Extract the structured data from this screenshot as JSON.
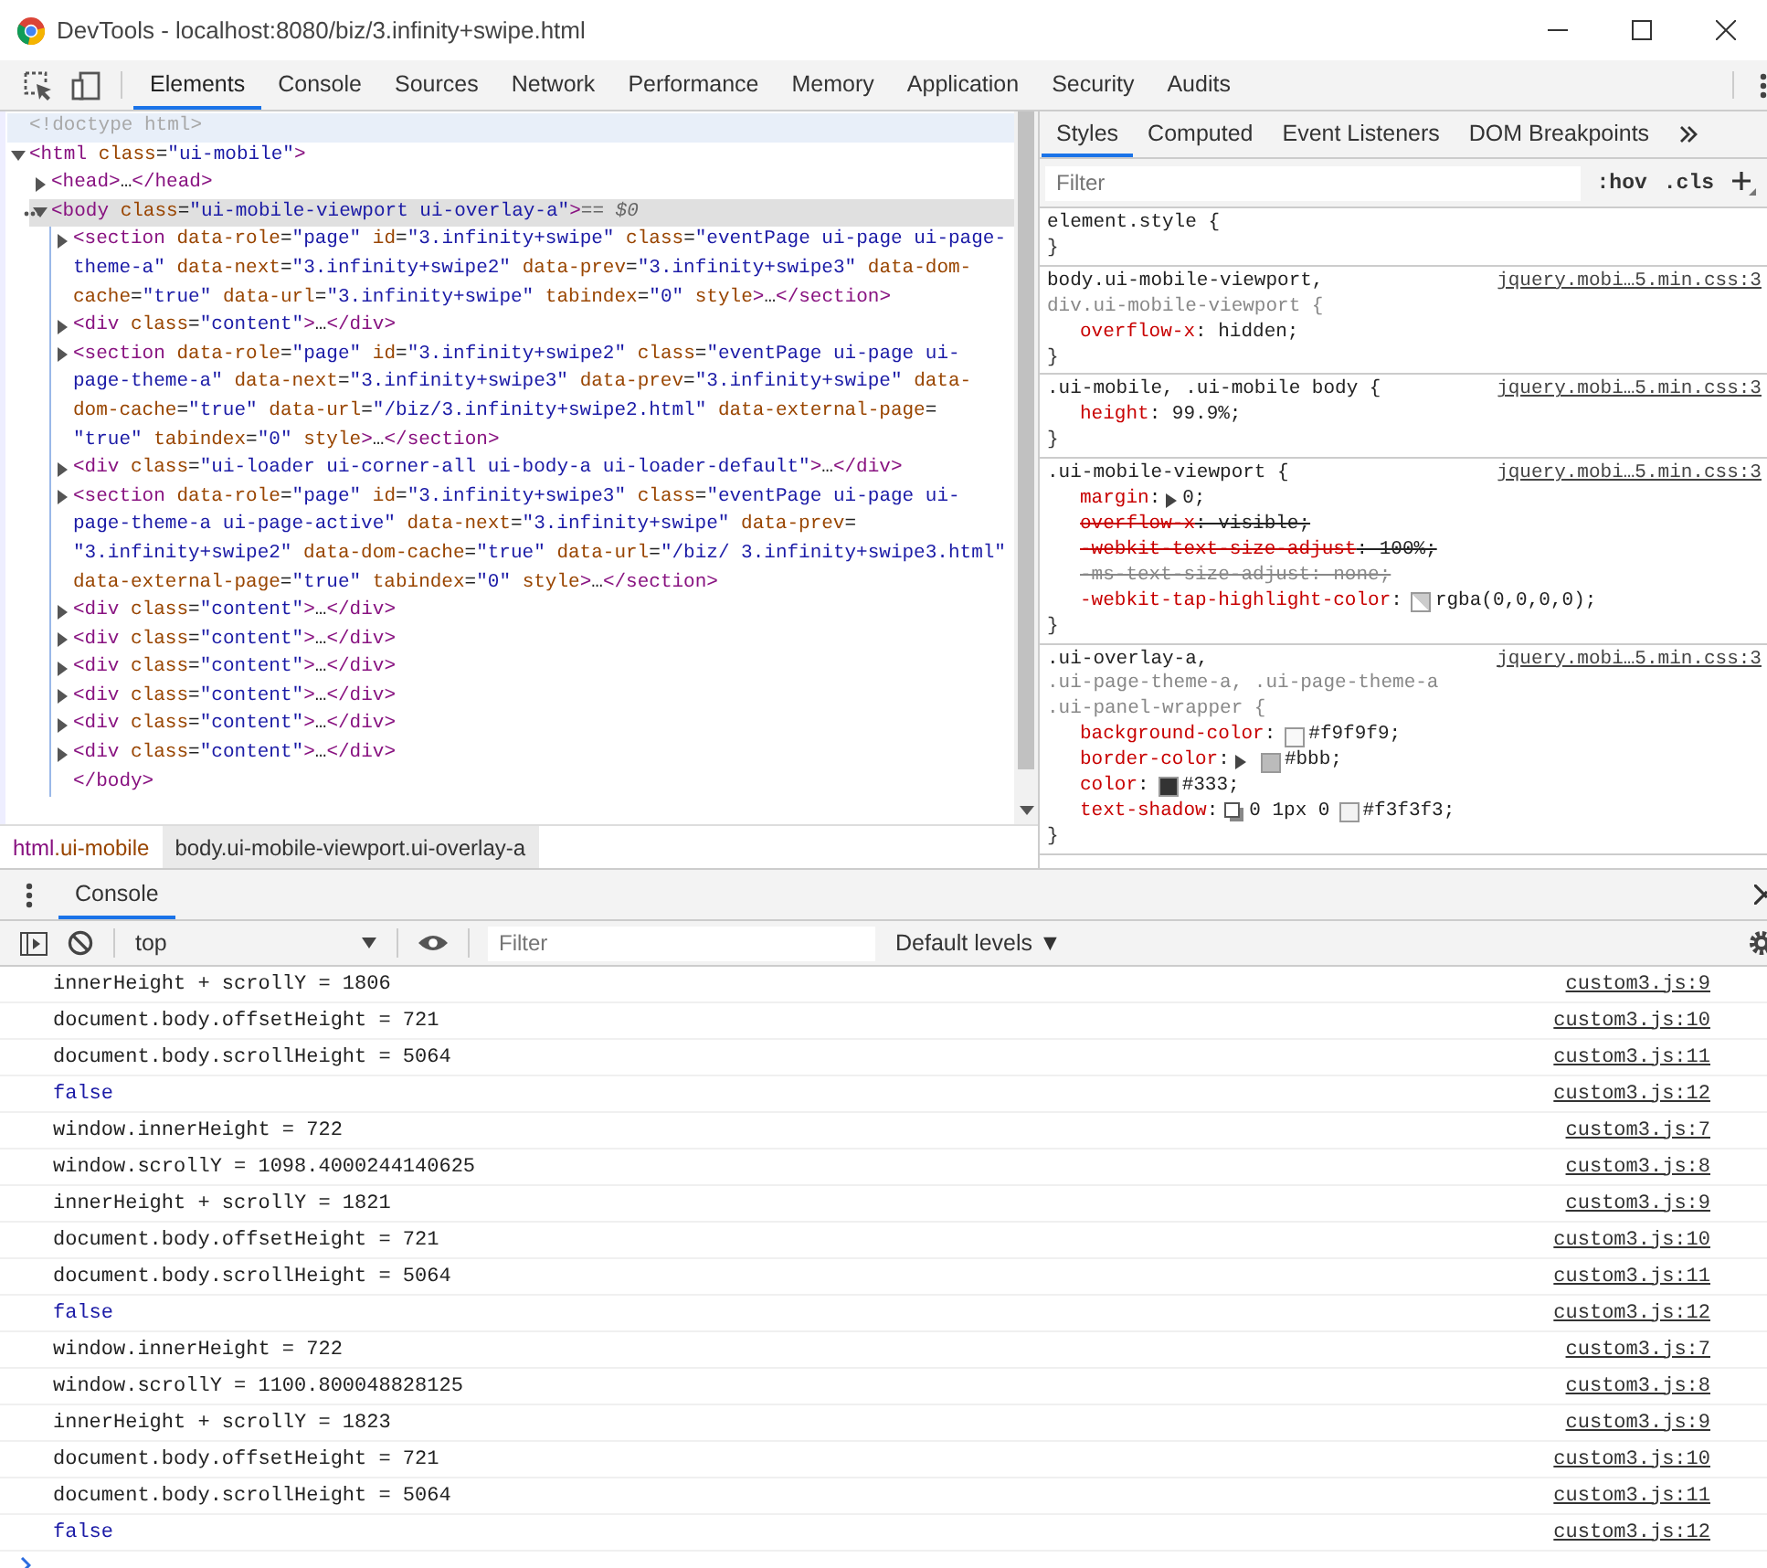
{
  "window": {
    "title": "DevTools - localhost:8080/biz/3.infinity+swipe.html"
  },
  "main_tabs": [
    {
      "label": "Elements",
      "selected": true
    },
    {
      "label": "Console",
      "selected": false
    },
    {
      "label": "Sources",
      "selected": false
    },
    {
      "label": "Network",
      "selected": false
    },
    {
      "label": "Performance",
      "selected": false
    },
    {
      "label": "Memory",
      "selected": false
    },
    {
      "label": "Application",
      "selected": false
    },
    {
      "label": "Security",
      "selected": false
    },
    {
      "label": "Audits",
      "selected": false
    }
  ],
  "elements": {
    "nodes": [
      {
        "kind": "doctype",
        "text": "<!doctype html>",
        "selected": false,
        "hovered": true
      },
      {
        "kind": "element",
        "text": "<html class=\"ui-mobile\">",
        "expanded": true,
        "selected": false,
        "hovered": false,
        "children": [
          {
            "kind": "element",
            "text": "<head>…</head>",
            "expanded": false,
            "selected": false,
            "hovered": false
          },
          {
            "kind": "element",
            "text": "<body class=\"ui-mobile-viewport ui-overlay-a\">",
            "suffix": "== $0",
            "expanded": true,
            "selected": true,
            "hovered": false,
            "close": "</body>",
            "children": [
              {
                "kind": "element",
                "text": "<section data-role=\"page\" id=\"3.infinity+swipe\" class=\"eventPage ui-page ui-page-theme-a\" data-next=\"3.infinity+swipe2\" data-prev=\"3.infinity+swipe3\" data-dom-cache=\"true\" data-url=\"3.infinity+swipe\" tabindex=\"0\" style>…</section>",
                "expanded": false,
                "selected": false,
                "hovered": false
              },
              {
                "kind": "element",
                "text": "<div class=\"content\">…</div>",
                "expanded": false,
                "selected": false,
                "hovered": false
              },
              {
                "kind": "element",
                "text": "<section data-role=\"page\" id=\"3.infinity+swipe2\" class=\"eventPage ui-page ui-page-theme-a\" data-next=\"3.infinity+swipe3\" data-prev=\"3.infinity+swipe\" data-dom-cache=\"true\" data-url=\"/biz/3.infinity+swipe2.html\" data-external-page= \"true\" tabindex=\"0\" style>…</section>",
                "expanded": false,
                "selected": false,
                "hovered": false
              },
              {
                "kind": "element",
                "text": "<div class=\"ui-loader ui-corner-all ui-body-a ui-loader-default\">…</div>",
                "expanded": false,
                "selected": false,
                "hovered": false
              },
              {
                "kind": "element",
                "text": "<section data-role=\"page\" id=\"3.infinity+swipe3\" class=\"eventPage ui-page ui-page-theme-a ui-page-active\" data-next=\"3.infinity+swipe\" data-prev= \"3.infinity+swipe2\" data-dom-cache=\"true\" data-url=\"/biz/ 3.infinity+swipe3.html\" data-external-page=\"true\" tabindex=\"0\" style>…</section>",
                "expanded": false,
                "selected": false,
                "hovered": false
              },
              {
                "kind": "element",
                "text": "<div class=\"content\">…</div>",
                "expanded": false,
                "selected": false,
                "hovered": false
              },
              {
                "kind": "element",
                "text": "<div class=\"content\">…</div>",
                "expanded": false,
                "selected": false,
                "hovered": false
              },
              {
                "kind": "element",
                "text": "<div class=\"content\">…</div>",
                "expanded": false,
                "selected": false,
                "hovered": false
              },
              {
                "kind": "element",
                "text": "<div class=\"content\">…</div>",
                "expanded": false,
                "selected": false,
                "hovered": false
              },
              {
                "kind": "element",
                "text": "<div class=\"content\">…</div>",
                "expanded": false,
                "selected": false,
                "hovered": false
              },
              {
                "kind": "element",
                "text": "<div class=\"content\">…</div>",
                "expanded": false,
                "selected": false,
                "hovered": false
              }
            ]
          }
        ]
      }
    ]
  },
  "breadcrumbs": [
    {
      "tag": "html",
      "classes": ".ui-mobile",
      "selected": false
    },
    {
      "tag": "body",
      "classes": ".ui-mobile-viewport.ui-overlay-a",
      "selected": true
    }
  ],
  "styles_tabs": [
    {
      "label": "Styles",
      "selected": true
    },
    {
      "label": "Computed",
      "selected": false
    },
    {
      "label": "Event Listeners",
      "selected": false
    },
    {
      "label": "DOM Breakpoints",
      "selected": false
    }
  ],
  "styles_filter": {
    "placeholder": "Filter",
    "buttons": [
      ":hov",
      ".cls"
    ]
  },
  "rules": [
    {
      "selectors": [
        {
          "text": "element.style {",
          "matched": true
        }
      ],
      "close": "}"
    },
    {
      "selectors": [
        {
          "text": "body.ui-mobile-viewport,",
          "matched": true
        },
        {
          "text": "div.ui-mobile-viewport {",
          "matched": false
        }
      ],
      "source": "jquery.mobi…5.min.css:3",
      "properties": [
        {
          "overridden": false,
          "supported": true,
          "parts": [
            {
              "kind": "name",
              "text": "overflow-x"
            },
            {
              "kind": "text",
              "text": ": hidden;"
            }
          ]
        }
      ],
      "close": "}"
    },
    {
      "selectors": [
        {
          "text": ".ui-mobile, .ui-mobile body {",
          "matched": true
        }
      ],
      "source": "jquery.mobi…5.min.css:3",
      "properties": [
        {
          "overridden": false,
          "supported": true,
          "parts": [
            {
              "kind": "name",
              "text": "height"
            },
            {
              "kind": "text",
              "text": ": 99.9%;"
            }
          ]
        }
      ],
      "close": "}"
    },
    {
      "selectors": [
        {
          "text": ".ui-mobile-viewport {",
          "matched": true
        }
      ],
      "source": "jquery.mobi…5.min.css:3",
      "properties": [
        {
          "overridden": false,
          "supported": true,
          "parts": [
            {
              "kind": "name",
              "text": "margin"
            },
            {
              "kind": "text",
              "text": ":"
            },
            {
              "kind": "expander"
            },
            {
              "kind": "text",
              "text": "0;"
            }
          ]
        },
        {
          "overridden": true,
          "supported": true,
          "parts": [
            {
              "kind": "name",
              "text": "overflow-x"
            },
            {
              "kind": "text",
              "text": ": visible;"
            }
          ]
        },
        {
          "overridden": true,
          "supported": true,
          "parts": [
            {
              "kind": "name",
              "text": "-webkit-text-size-adjust"
            },
            {
              "kind": "text",
              "text": ": 100%;"
            }
          ]
        },
        {
          "overridden": false,
          "supported": false,
          "parts": [
            {
              "kind": "name",
              "text": "-ms-text-size-adjust"
            },
            {
              "kind": "text",
              "text": ": none;"
            }
          ]
        },
        {
          "overridden": false,
          "supported": true,
          "parts": [
            {
              "kind": "name",
              "text": "-webkit-tap-highlight-color"
            },
            {
              "kind": "text",
              "text": ":"
            },
            {
              "kind": "checker-swatch"
            },
            {
              "kind": "text",
              "text": "rgba(0,0,0,0);"
            }
          ]
        }
      ],
      "close": "}"
    },
    {
      "selectors": [
        {
          "text": ".ui-overlay-a,",
          "matched": true
        },
        {
          "text": ".ui-page-theme-a, .ui-page-theme-a .ui-panel-wrapper {",
          "matched": false
        }
      ],
      "source": "jquery.mobi…5.min.css:3",
      "properties": [
        {
          "overridden": false,
          "supported": true,
          "parts": [
            {
              "kind": "name",
              "text": "background-color"
            },
            {
              "kind": "text",
              "text": ":"
            },
            {
              "kind": "swatch",
              "color": "#f9f9f9"
            },
            {
              "kind": "text",
              "text": "#f9f9f9;"
            }
          ]
        },
        {
          "overridden": false,
          "supported": true,
          "parts": [
            {
              "kind": "name",
              "text": "border-color"
            },
            {
              "kind": "text",
              "text": ":"
            },
            {
              "kind": "expander"
            },
            {
              "kind": "swatch",
              "color": "#bbbbbb"
            },
            {
              "kind": "text",
              "text": "#bbb;"
            }
          ]
        },
        {
          "overridden": false,
          "supported": true,
          "parts": [
            {
              "kind": "name",
              "text": "color"
            },
            {
              "kind": "text",
              "text": ":"
            },
            {
              "kind": "swatch",
              "color": "#333333"
            },
            {
              "kind": "text",
              "text": "#333;"
            }
          ]
        },
        {
          "overridden": false,
          "supported": true,
          "parts": [
            {
              "kind": "name",
              "text": "text-shadow"
            },
            {
              "kind": "text",
              "text": ":"
            },
            {
              "kind": "shadow"
            },
            {
              "kind": "text",
              "text": "0 1px 0"
            },
            {
              "kind": "swatch",
              "color": "#f3f3f3"
            },
            {
              "kind": "text",
              "text": "#f3f3f3;"
            }
          ]
        }
      ],
      "close": "}"
    }
  ],
  "drawer_tabs": [
    {
      "label": "Console",
      "selected": true
    }
  ],
  "console": {
    "context": "top",
    "filter_placeholder": "Filter",
    "levels": "Default levels ▼",
    "messages": [
      {
        "kind": "log",
        "text": "innerHeight + scrollY = 1806",
        "source": "custom3.js:9"
      },
      {
        "kind": "log",
        "text": "document.body.offsetHeight = 721",
        "source": "custom3.js:10"
      },
      {
        "kind": "log",
        "text": "document.body.scrollHeight = 5064",
        "source": "custom3.js:11"
      },
      {
        "kind": "boolean",
        "text": "false",
        "source": "custom3.js:12"
      },
      {
        "kind": "log",
        "text": "window.innerHeight = 722",
        "source": "custom3.js:7"
      },
      {
        "kind": "log",
        "text": "window.scrollY = 1098.4000244140625",
        "source": "custom3.js:8"
      },
      {
        "kind": "log",
        "text": "innerHeight + scrollY = 1821",
        "source": "custom3.js:9"
      },
      {
        "kind": "log",
        "text": "document.body.offsetHeight = 721",
        "source": "custom3.js:10"
      },
      {
        "kind": "log",
        "text": "document.body.scrollHeight = 5064",
        "source": "custom3.js:11"
      },
      {
        "kind": "boolean",
        "text": "false",
        "source": "custom3.js:12"
      },
      {
        "kind": "log",
        "text": "window.innerHeight = 722",
        "source": "custom3.js:7"
      },
      {
        "kind": "log",
        "text": "window.scrollY = 1100.800048828125",
        "source": "custom3.js:8"
      },
      {
        "kind": "log",
        "text": "innerHeight + scrollY = 1823",
        "source": "custom3.js:9"
      },
      {
        "kind": "log",
        "text": "document.body.offsetHeight = 721",
        "source": "custom3.js:10"
      },
      {
        "kind": "log",
        "text": "document.body.scrollHeight = 5064",
        "source": "custom3.js:11"
      },
      {
        "kind": "boolean",
        "text": "false",
        "source": "custom3.js:12"
      }
    ]
  }
}
